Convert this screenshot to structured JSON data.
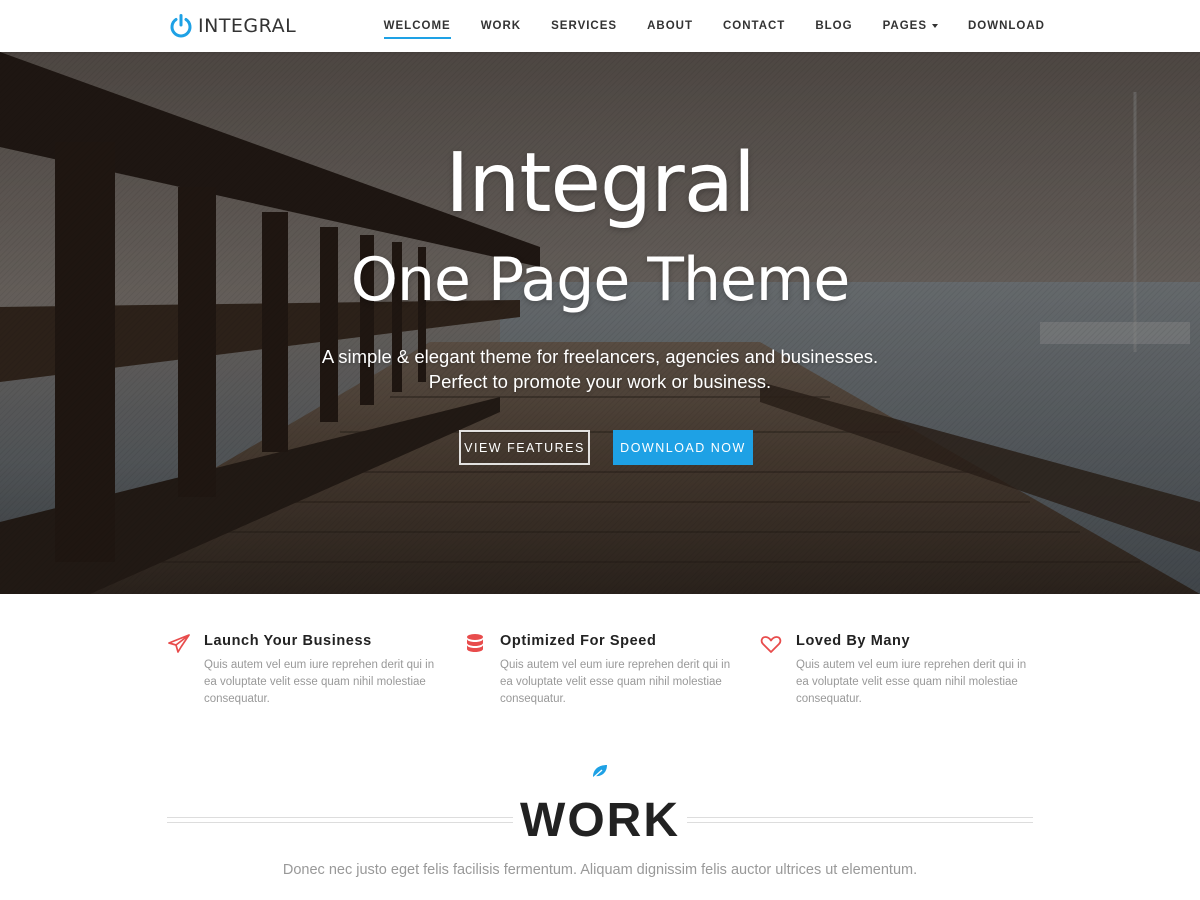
{
  "brand": {
    "name": "INTEGRAL",
    "accent": "#1ea1e5"
  },
  "nav": {
    "items": [
      {
        "label": "WELCOME",
        "active": true
      },
      {
        "label": "WORK"
      },
      {
        "label": "SERVICES"
      },
      {
        "label": "ABOUT"
      },
      {
        "label": "CONTACT"
      },
      {
        "label": "BLOG"
      },
      {
        "label": "PAGES",
        "dropdown": true
      },
      {
        "label": "DOWNLOAD"
      }
    ]
  },
  "hero": {
    "title_line1": "Integral",
    "title_line2": "One Page Theme",
    "subtitle_line1": "A simple & elegant theme for freelancers, agencies and businesses.",
    "subtitle_line2": "Perfect to promote your work or business.",
    "buttons": {
      "features": "VIEW FEATURES",
      "download": "DOWNLOAD NOW"
    }
  },
  "features": [
    {
      "icon": "paper-plane-icon",
      "title": "Launch Your Business",
      "text": "Quis autem vel eum iure reprehen derit qui in ea voluptate velit esse quam nihil molestiae consequatur.",
      "icon_color": "#e84c4c"
    },
    {
      "icon": "database-icon",
      "title": "Optimized For Speed",
      "text": "Quis autem vel eum iure reprehen derit qui in ea voluptate velit esse quam nihil molestiae consequatur.",
      "icon_color": "#e84c4c"
    },
    {
      "icon": "heart-icon",
      "title": "Loved By Many",
      "text": "Quis autem vel eum iure reprehen derit qui in ea voluptate velit esse quam nihil molestiae consequatur.",
      "icon_color": "#e84c4c"
    }
  ],
  "work": {
    "icon": "leaf-icon",
    "title": "WORK",
    "subtitle": "Donec nec justo eget felis facilisis fermentum. Aliquam dignissim felis auctor ultrices ut elementum."
  }
}
